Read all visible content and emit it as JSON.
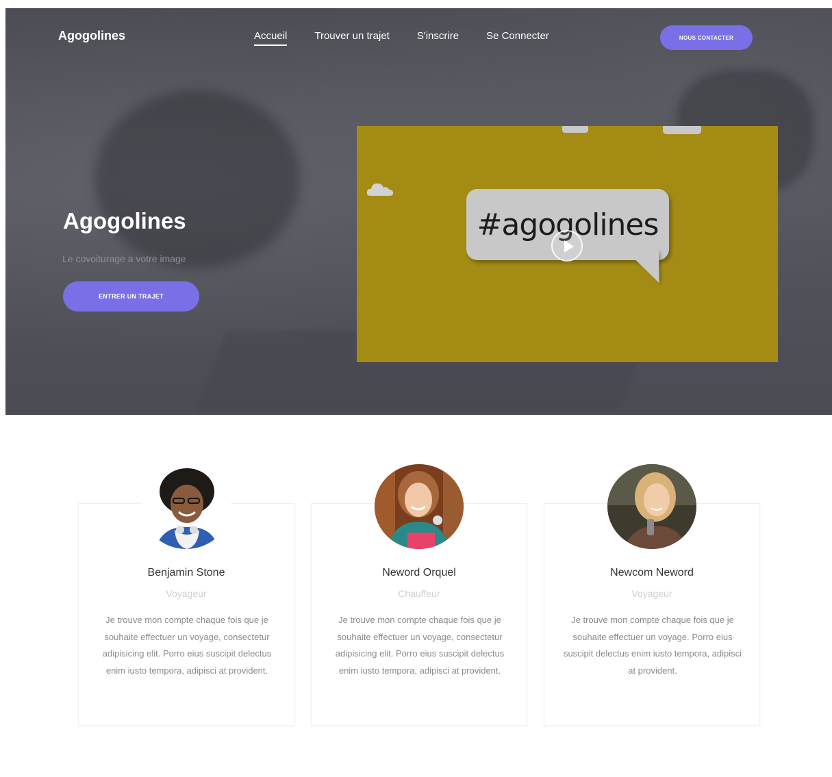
{
  "header": {
    "brand": "Agogolines",
    "nav": [
      {
        "label": "Accueil",
        "active": true
      },
      {
        "label": "Trouver un trajet",
        "active": false
      },
      {
        "label": "S'inscrire",
        "active": false
      },
      {
        "label": "Se Connecter",
        "active": false
      }
    ],
    "contact_button": "NOUS CONTACTER"
  },
  "hero": {
    "title": "Agogolines",
    "subtitle": "Le covoiturage a votre image",
    "cta_button": "ENTRER UN TRAJET",
    "video": {
      "hashtag": "#agogolines",
      "background_color": "#a48c14"
    }
  },
  "colors": {
    "accent": "#7b6fe8",
    "hero_overlay": "#4b4c53"
  },
  "testimonials": [
    {
      "name": "Benjamin Stone",
      "role": "Voyageur",
      "text": "Je trouve mon compte chaque fois que je souhaite effectuer un voyage, consectetur adipisicing elit. Porro eius suscipit delectus enim iusto tempora, adipisci at provident."
    },
    {
      "name": "Neword Orquel",
      "role": "Chauffeur",
      "text": "Je trouve mon compte chaque fois que je souhaite effectuer un voyage, consectetur adipisicing elit. Porro eius suscipit delectus enim iusto tempora, adipisci at provident."
    },
    {
      "name": "Newcom Neword",
      "role": "Voyageur",
      "text": "Je trouve mon compte chaque fois que je souhaite effectuer un voyage. Porro eius suscipit delectus enim iusto tempora, adipisci at provident."
    }
  ]
}
